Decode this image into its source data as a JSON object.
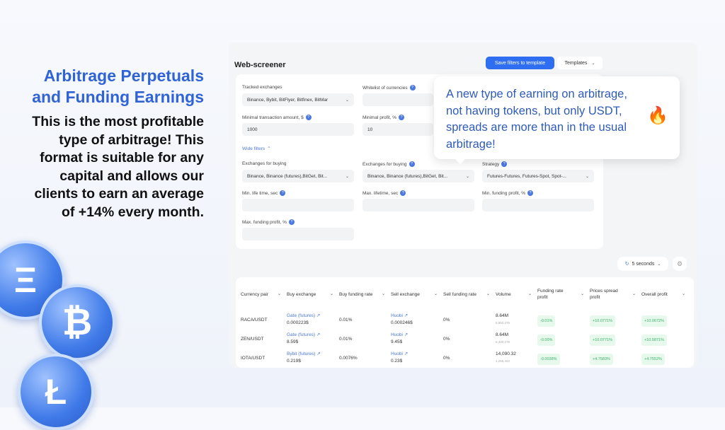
{
  "hero": {
    "title": "Arbitrage Perpetuals and Funding Earnings",
    "text": "This is the most profitable type of arbitrage! This format is suitable for any capital and allows our clients to earn an average of +14% every month."
  },
  "coins": [
    "ethereum-coin",
    "bitcoin-coin",
    "litecoin-coin"
  ],
  "app": {
    "title": "Web-screener",
    "save_label": "Save filters to template",
    "templates_label": "Templates"
  },
  "filters": {
    "tracked_label": "Tracked exchanges",
    "tracked_value": "Binance, Bybit, BitFlyer, Bitfinex, BitMar",
    "whitelist_label": "Whitelist of currencies",
    "min_amount_label": "Minimal transaction amount, $",
    "min_amount_value": "1000",
    "min_profit_label": "Minimal profit, %",
    "min_profit_value": "10",
    "wide_filters": "Wide filters",
    "buy1_label": "Exchanges for buying",
    "buy1_value": "Binance, Binance (futures),BitGet, Bit...",
    "buy2_label": "Exchanges for buying",
    "buy2_value": "Binance, Binance (futures),BitGet, Bit...",
    "strategy_label": "Strategy",
    "strategy_value": "Futures-Futures, Futures-Spot, Spot-...",
    "min_life_label": "Min. life time, sec",
    "max_life_label": "Max. lifetime, sec",
    "min_funding_label": "Min. funding profit, %",
    "max_funding_label": "Max. funding profit, %"
  },
  "tooltip": {
    "text": "A new type of earning on arbitrage, not having tokens, but only USDT, spreads are more than in the usual arbitrage!",
    "icon": "fire-icon"
  },
  "refresh": {
    "value": "5 seconds"
  },
  "colors": {
    "accent": "#2f6ef0",
    "title": "#2f63d6",
    "positive": "#3db36a"
  },
  "table": {
    "headers": [
      "Currency pair",
      "Buy exchange",
      "Buy funding rate",
      "Sell exchange",
      "Sell funding rate",
      "Volume",
      "Funding rate profit",
      "Prices spread profit",
      "Overall profit"
    ],
    "rows": [
      {
        "pair": "RACA/USDT",
        "buy_ex": "Gate (futures)",
        "buy_price": "0.000223$",
        "buy_rate": "0.01%",
        "sell_ex": "Huobi",
        "sell_price": "0.000246$",
        "sell_rate": "0%",
        "volume": "8.64M",
        "volume_sub": "5,952,275",
        "funding": "-0.01%",
        "spread": "+10.0771%",
        "overall": "+10.0672%"
      },
      {
        "pair": "ZEN/USDT",
        "buy_ex": "Gate (futures)",
        "buy_price": "8.59$",
        "buy_rate": "0.01%",
        "sell_ex": "Huobi",
        "sell_price": "9.45$",
        "sell_rate": "0%",
        "volume": "8.64M",
        "volume_sub": "6,432,275",
        "funding": "-0.00%",
        "spread": "+10.0771%",
        "overall": "+10.5871%"
      },
      {
        "pair": "IOTA/USDT",
        "buy_ex": "Bybit (futures)",
        "buy_price": "0.219$",
        "buy_rate": "0.0076%",
        "sell_ex": "Huobi",
        "sell_price": "0.23$",
        "sell_rate": "0%",
        "volume": "14,090.32",
        "volume_sub": "1,265,442",
        "funding": "-0.0038%",
        "spread": "+4.7583%",
        "overall": "+4.7552%"
      }
    ]
  }
}
